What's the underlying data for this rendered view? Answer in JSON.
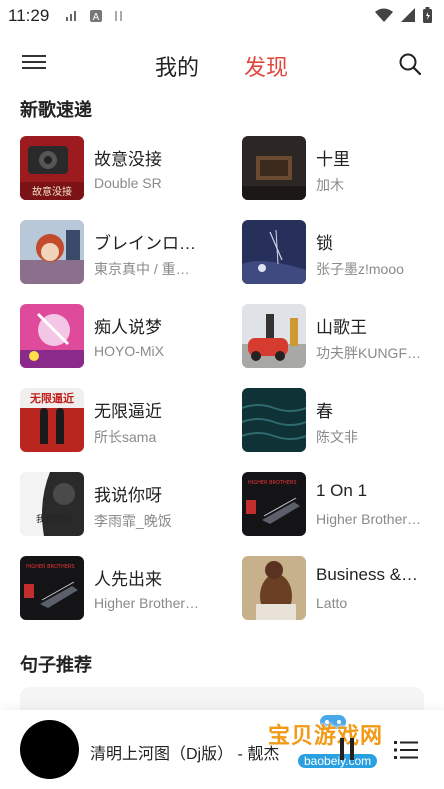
{
  "status_bar": {
    "time": "11:29"
  },
  "nav": {
    "tab_mine": "我的",
    "tab_discover": "发现"
  },
  "icons": {
    "menu": "hamburger-icon",
    "search": "search-icon",
    "pause": "pause-icon",
    "playlist": "playlist-icon"
  },
  "colors": {
    "accent": "#e0463c",
    "text": "#222222",
    "secondary": "#8a8a8a"
  },
  "sections": {
    "new_songs": "新歌速递",
    "sentences": "句子推荐"
  },
  "songs": [
    {
      "title": "故意没接",
      "artist": "Double SR"
    },
    {
      "title": "十里",
      "artist": "加木"
    },
    {
      "title": "ブレインロ…",
      "artist": "東京真中 / 重…"
    },
    {
      "title": "锁",
      "artist": "张子墨z!mooo"
    },
    {
      "title": "痴人说梦",
      "artist": "HOYO-MiX"
    },
    {
      "title": "山歌王",
      "artist": "功夫胖KUNGF…"
    },
    {
      "title": "无限逼近",
      "artist": "所长sama"
    },
    {
      "title": "春",
      "artist": "陈文非"
    },
    {
      "title": "我说你呀",
      "artist": "李雨霏_晚饭"
    },
    {
      "title": "1 On 1",
      "artist": "Higher Brother…"
    },
    {
      "title": "人先出来",
      "artist": "Higher Brother…"
    },
    {
      "title": "Business &…",
      "artist": "Latto"
    }
  ],
  "cover_texts": {
    "c1": "故意没接",
    "c7": "无限逼近",
    "c9": "我说你呀",
    "c10": "HIGHER BROTHERS",
    "c11": "HIGHER BROTHERS"
  },
  "player": {
    "title": "清明上河图（Dj版） - 靓杰"
  },
  "watermark": {
    "text": "宝贝游戏网",
    "url": "baobeiy.com"
  }
}
